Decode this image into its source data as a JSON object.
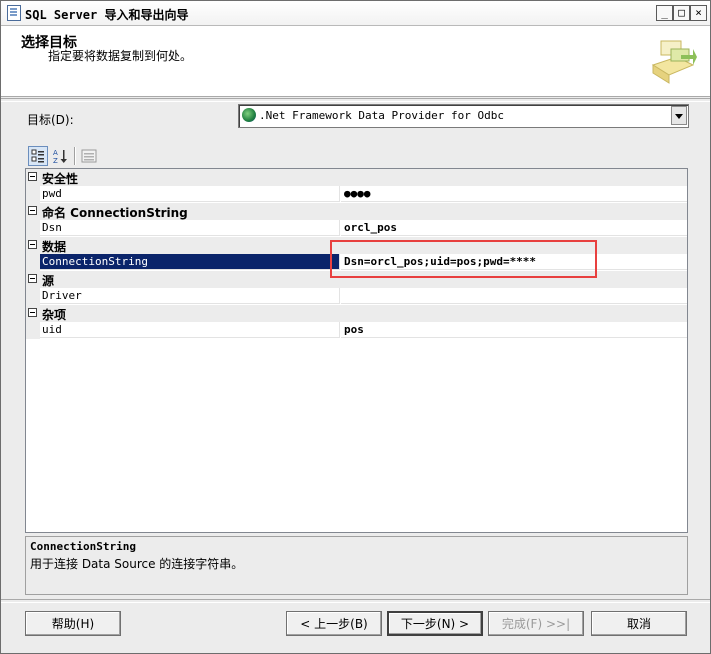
{
  "window": {
    "title": "SQL Server 导入和导出向导",
    "controls": [
      "_",
      "□",
      "×"
    ]
  },
  "header": {
    "title": "选择目标",
    "subtitle": "指定要将数据复制到何处。"
  },
  "destination": {
    "label": "目标(D):",
    "selected": ".Net Framework Data Provider for Odbc"
  },
  "toolbar": {
    "categorized_icon": "categorized-icon",
    "alphabetical_icon": "alphabetical-sort-icon",
    "property_pages_icon": "property-pages-icon"
  },
  "property_grid": {
    "groups": [
      {
        "label": "安全性",
        "rows": [
          {
            "name": "pwd",
            "value": "●●●●"
          }
        ]
      },
      {
        "label": "命名 ConnectionString",
        "rows": [
          {
            "name": "Dsn",
            "value": "orcl_pos"
          }
        ]
      },
      {
        "label": "数据",
        "rows": [
          {
            "name": "ConnectionString",
            "value": "Dsn=orcl_pos;uid=pos;pwd=****"
          }
        ]
      },
      {
        "label": "源",
        "rows": [
          {
            "name": "Driver",
            "value": ""
          }
        ]
      },
      {
        "label": "杂项",
        "rows": [
          {
            "name": "uid",
            "value": "pos"
          }
        ]
      }
    ],
    "selected_row": "ConnectionString"
  },
  "description": {
    "title": "ConnectionString",
    "text": "用于连接 Data Source 的连接字符串。"
  },
  "buttons": {
    "help": "帮助(H)",
    "back": "< 上一步(B)",
    "next": "下一步(N) >",
    "finish": "完成(F) >>|",
    "cancel": "取消"
  },
  "colors": {
    "selection": "#0a246a",
    "highlight_box": "#e8403f"
  }
}
